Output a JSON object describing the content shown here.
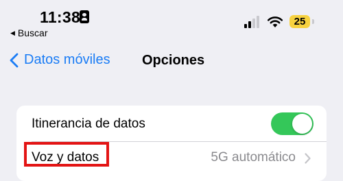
{
  "status_bar": {
    "time": "11:38",
    "back_app_label": "Buscar",
    "battery_level": "25",
    "icons": [
      "person-id-icon",
      "cellular-signal-icon",
      "wifi-icon",
      "battery-icon"
    ],
    "battery_color": "#f7d23f"
  },
  "nav": {
    "back_label": "Datos móviles",
    "title": "Opciones",
    "accent_color": "#1a7cf5"
  },
  "settings": {
    "rows": [
      {
        "label": "Itinerancia de datos",
        "control": "toggle",
        "toggle_on": true,
        "toggle_color": "#34c759"
      },
      {
        "label": "Voz y datos",
        "value": "5G automático",
        "control": "chevron",
        "highlighted": true,
        "highlight_color": "#e31414"
      }
    ]
  }
}
